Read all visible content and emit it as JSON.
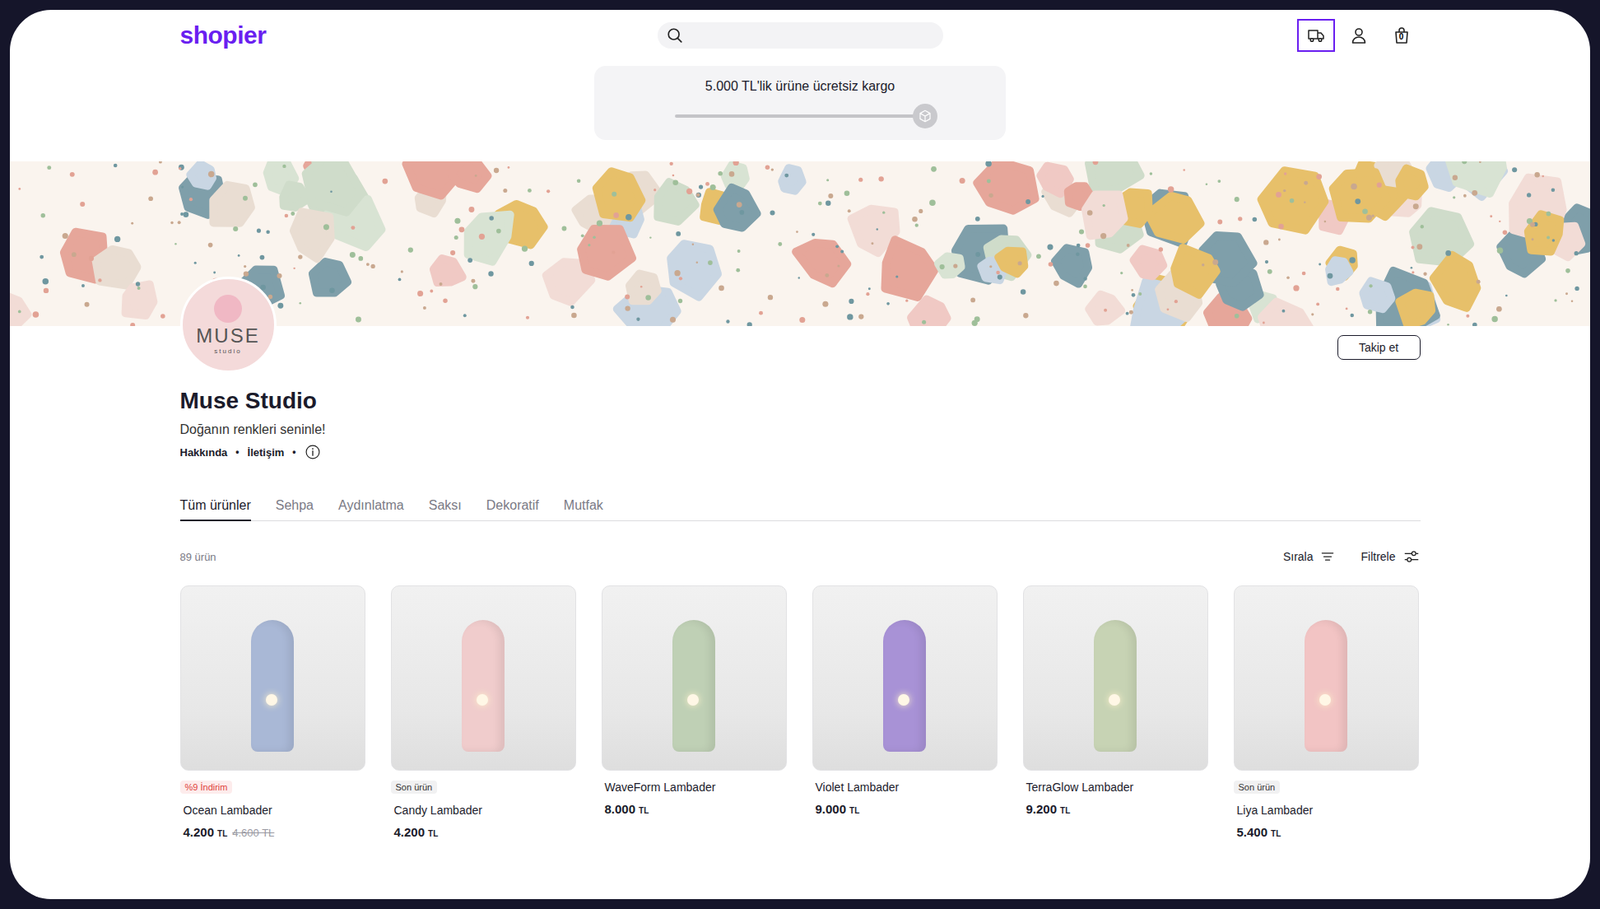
{
  "header": {
    "logo": "shopier",
    "shipping_button": {
      "selected": true
    },
    "cart_count": "0"
  },
  "shipping_banner": {
    "text": "5.000 TL'lik ürüne ücretsiz kargo",
    "level": 1
  },
  "store": {
    "avatar": {
      "title": "MUSE",
      "subtitle": "studio"
    },
    "name": "Muse Studio",
    "tagline": "Doğanın renkleri seninle!",
    "links": [
      "Hakkında",
      "İletişim"
    ],
    "separator": "•",
    "follow_button": "Takip et"
  },
  "tabs": [
    {
      "label": "Tüm ürünler",
      "selected": true
    },
    {
      "label": "Sehpa",
      "selected": false
    },
    {
      "label": "Aydınlatma",
      "selected": false
    },
    {
      "label": "Saksı",
      "selected": false
    },
    {
      "label": "Dekoratif",
      "selected": false
    },
    {
      "label": "Mutfak",
      "selected": false
    }
  ],
  "toolbar": {
    "count": "89 ürün",
    "sort": "Sırala",
    "filter": "Filtrele"
  },
  "products": [
    {
      "name": "Ocean Lambader",
      "price": "4.200",
      "currency": "TL",
      "old_price": "4.600",
      "badge": {
        "text": "%9 İndirim",
        "kind": "discount"
      },
      "color": "#a9b8d6"
    },
    {
      "name": "Candy Lambader",
      "price": "4.200",
      "currency": "TL",
      "old_price": null,
      "badge": {
        "text": "Son ürün",
        "kind": "stock"
      },
      "color": "#f0cccc"
    },
    {
      "name": "WaveForm Lambader",
      "price": "8.000",
      "currency": "TL",
      "old_price": null,
      "badge": null,
      "color": "#bfd0b5"
    },
    {
      "name": "Violet Lambader",
      "price": "9.000",
      "currency": "TL",
      "old_price": null,
      "badge": null,
      "color": "#a892d6"
    },
    {
      "name": "TerraGlow Lambader",
      "price": "9.200",
      "currency": "TL",
      "old_price": null,
      "badge": null,
      "color": "#c7d3b4"
    },
    {
      "name": "Liya Lambader",
      "price": "5.400",
      "currency": "TL",
      "old_price": null,
      "badge": {
        "text": "Son ürün",
        "kind": "stock"
      },
      "color": "#f2c4c4"
    }
  ]
}
